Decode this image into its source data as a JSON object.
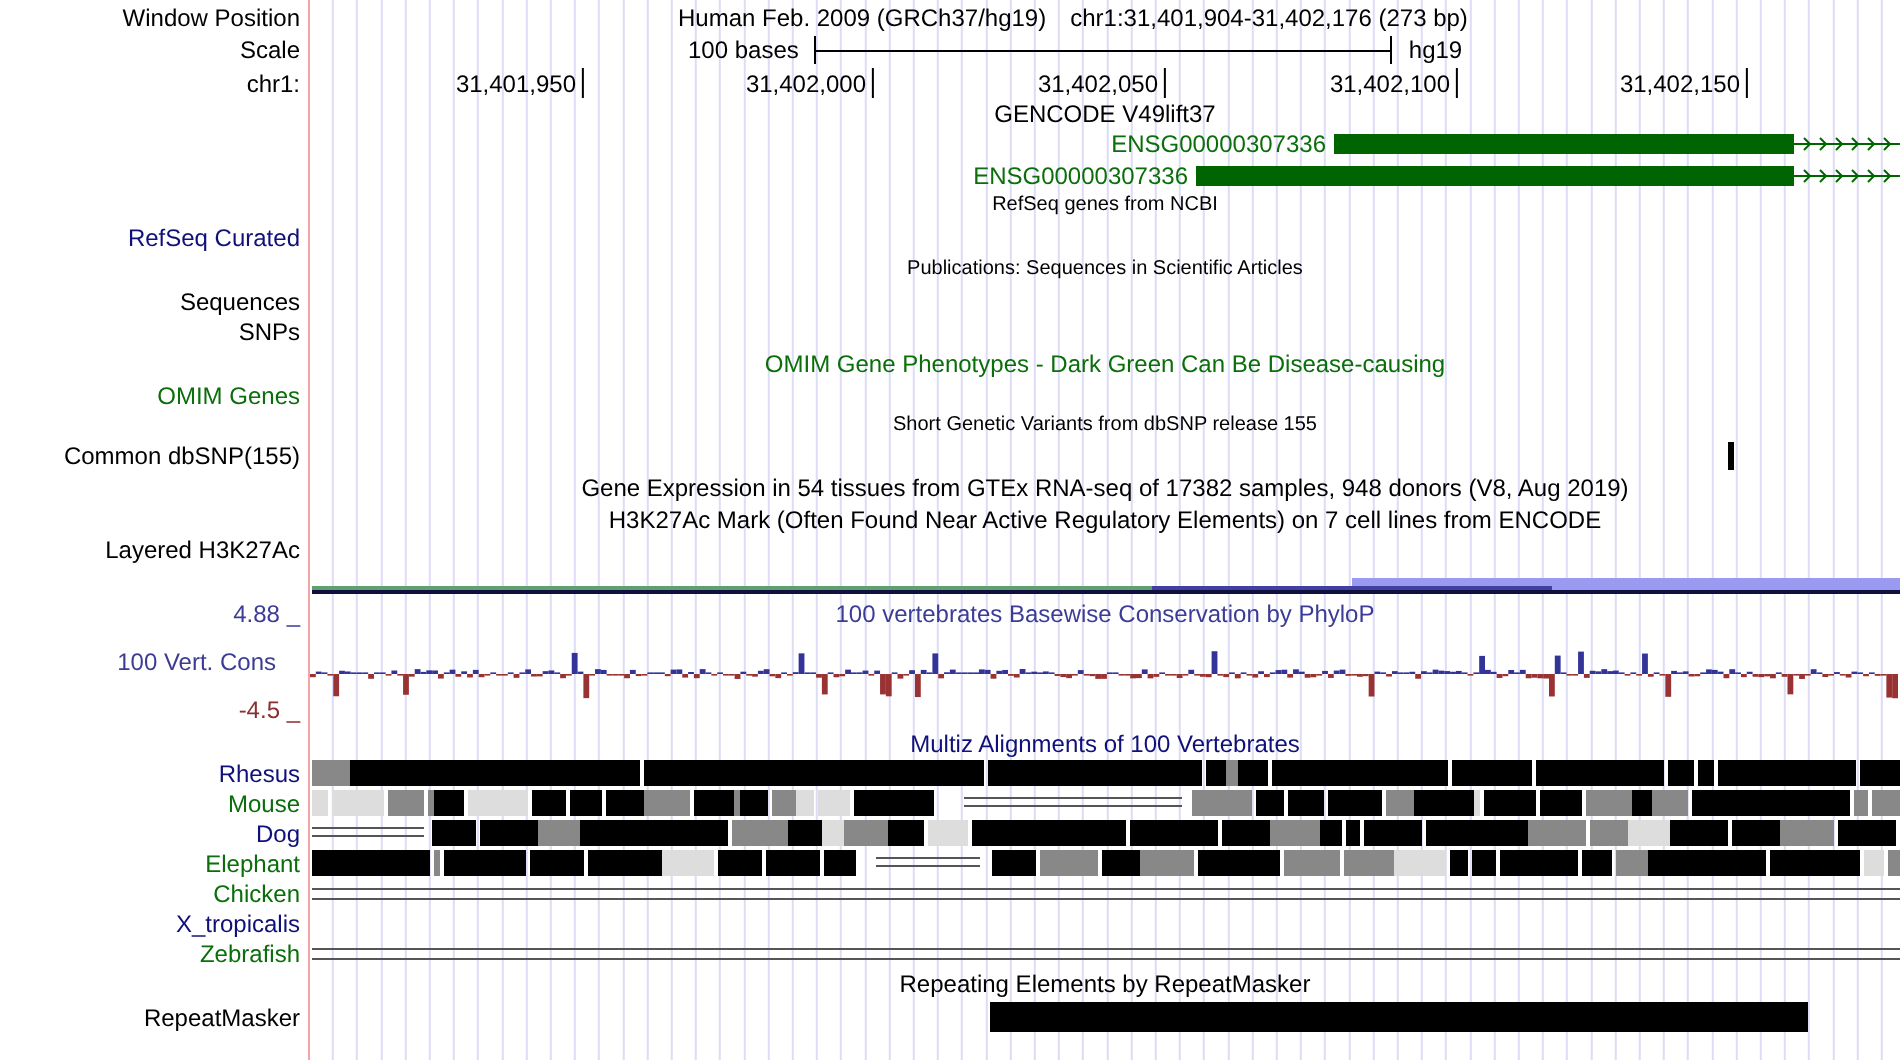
{
  "position": {
    "label": "Window Position",
    "assembly": "Human Feb. 2009 (GRCh37/hg19)",
    "range": "chr1:31,401,904-31,402,176 (273 bp)"
  },
  "scale": {
    "label": "Scale",
    "length": "100 bases",
    "assembly": "hg19"
  },
  "ruler": {
    "label": "chr1:",
    "ticks": [
      "31,401,950",
      "31,402,000",
      "31,402,050",
      "31,402,100",
      "31,402,150"
    ]
  },
  "tracks": [
    {
      "kind": "genes",
      "title": "GENCODE V49lift37",
      "genes": [
        {
          "name": "ENSG00000307336"
        },
        {
          "name": "ENSG00000307336"
        }
      ]
    },
    {
      "kind": "features",
      "title": "RefSeq genes from NCBI",
      "labels": [
        {
          "text": "RefSeq Curated",
          "color": "#10107a"
        }
      ]
    },
    {
      "kind": "features",
      "title": "Publications: Sequences in Scientific Articles",
      "labels": [
        {
          "text": "Sequences",
          "color": "#000000"
        },
        {
          "text": "SNPs",
          "color": "#000000"
        }
      ]
    },
    {
      "kind": "phenotypes",
      "title": "OMIM Gene Phenotypes - Dark Green Can Be Disease-causing",
      "labels": [
        {
          "text": "OMIM Genes",
          "color": "#0a6e0a"
        }
      ]
    },
    {
      "kind": "variants",
      "title": "Short Genetic Variants from dbSNP release 155",
      "labels": [
        {
          "text": "Common dbSNP(155)",
          "color": "#000000"
        }
      ]
    },
    {
      "kind": "expression",
      "title": "Gene Expression in 54 tissues from GTEx RNA-seq of 17382 samples, 948 donors (V8, Aug 2019)"
    },
    {
      "kind": "signal",
      "title": "H3K27Ac Mark (Often Found Near Active Regulatory Elements) on 7 cell lines from ENCODE",
      "labels": [
        {
          "text": "Layered H3K27Ac",
          "color": "#000000"
        }
      ]
    },
    {
      "kind": "conservation",
      "title": "100 vertebrates Basewise Conservation by PhyloP",
      "label": "100 Vert. Cons",
      "max": "4.88 _",
      "min": "-4.5 _"
    },
    {
      "kind": "alignment",
      "title": "Multiz Alignments of 100 Vertebrates",
      "species": [
        {
          "name": "Rhesus",
          "color": "#10107a",
          "kind": "blocks"
        },
        {
          "name": "Mouse",
          "color": "#0a6e0a",
          "kind": "blocks"
        },
        {
          "name": "Dog",
          "color": "#10107a",
          "kind": "blocks"
        },
        {
          "name": "Elephant",
          "color": "#0a6e0a",
          "kind": "blocks"
        },
        {
          "name": "Chicken",
          "color": "#0a6e0a",
          "kind": "lines"
        },
        {
          "name": "X_tropicalis",
          "color": "#10107a",
          "kind": "none"
        },
        {
          "name": "Zebrafish",
          "color": "#0a6e0a",
          "kind": "lines"
        }
      ]
    },
    {
      "kind": "repeats",
      "title": "Repeating Elements by RepeatMasker",
      "labels": [
        {
          "text": "RepeatMasker",
          "color": "#000000"
        }
      ]
    }
  ]
}
